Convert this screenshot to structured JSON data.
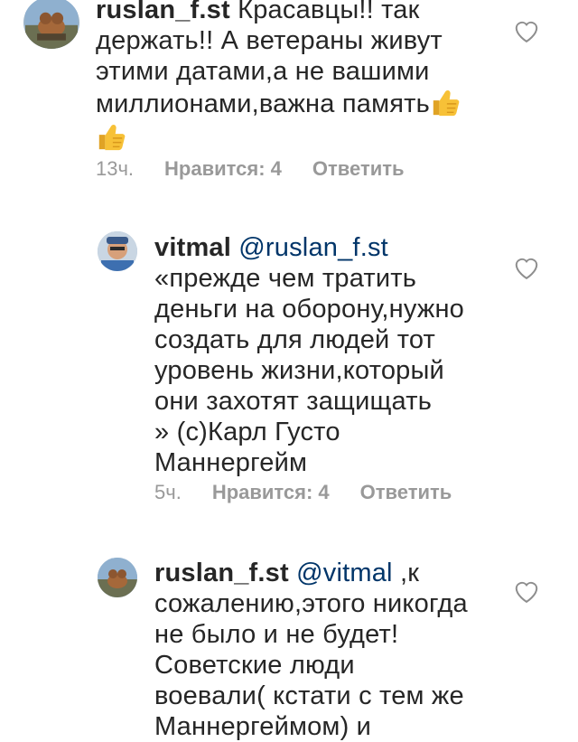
{
  "comments": [
    {
      "username": "ruslan_f.st",
      "mention": "",
      "text_lines": [
        "Красавцы!! так",
        "держать!! А ветераны живут",
        "этими датами,а не вашими",
        "миллионами,важна память"
      ],
      "emoji": "thumbs-up",
      "time": "13ч.",
      "likes_label": "Нравится: 4",
      "reply_label": "Ответить"
    },
    {
      "username": "vitmal",
      "mention": "@ruslan_f.st",
      "text_lines": [
        "«прежде чем тратить",
        "деньги на оборону,нужно",
        "создать для людей тот",
        "уровень жизни,который",
        "они захотят защищать",
        "» (с)Карл Густо",
        "Маннергейм"
      ],
      "time": "5ч.",
      "likes_label": "Нравится: 4",
      "reply_label": "Ответить"
    },
    {
      "username": "ruslan_f.st",
      "mention": "@vitmal",
      "text_lines": [
        " ,к",
        "сожалению,этого никогда",
        "не было и не будет!",
        "Советские люди",
        "воевали( кстати с тем же",
        "Маннергеймом) и"
      ]
    }
  ],
  "icons": {
    "heart": "heart-icon",
    "thumbs_up": "thumbs-up-emoji"
  },
  "colors": {
    "text": "#262626",
    "meta": "#999999",
    "mention": "#003569",
    "thumb": "#f7c137"
  }
}
